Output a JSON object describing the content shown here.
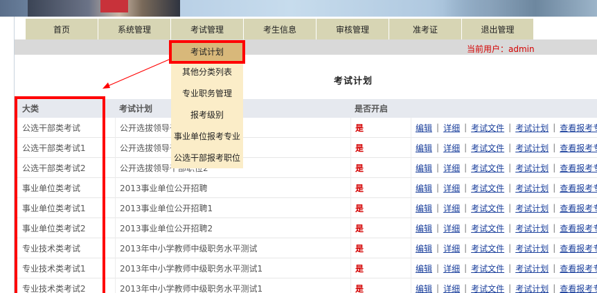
{
  "nav": {
    "items": [
      "首页",
      "系统管理",
      "考试管理",
      "考生信息",
      "审核管理",
      "准考证",
      "退出管理"
    ]
  },
  "status": {
    "current_user": "当前用户：admin"
  },
  "page": {
    "title": "考试计划"
  },
  "dropdown": {
    "items": [
      "考试计划",
      "其他分类列表",
      "专业职务管理",
      "报考级别",
      "事业单位报考专业",
      "公选干部报考职位"
    ]
  },
  "table": {
    "headers": [
      "大类",
      "考试计划",
      "是否开启",
      ""
    ],
    "actions": [
      "编辑",
      "详细",
      "考试文件",
      "考试计划",
      "查看报考专业"
    ],
    "rows": [
      {
        "category": "公选干部类考试",
        "plan": "公开选拔领导干部职位",
        "open": "是"
      },
      {
        "category": "公选干部类考试1",
        "plan": "公开选拔领导干部职位1",
        "open": "是"
      },
      {
        "category": "公选干部类考试2",
        "plan": "公开选拔领导干部职位2",
        "open": "是"
      },
      {
        "category": "事业单位类考试",
        "plan": "2013事业单位公开招聘",
        "open": "是"
      },
      {
        "category": "事业单位类考试1",
        "plan": "2013事业单位公开招聘1",
        "open": "是"
      },
      {
        "category": "事业单位类考试2",
        "plan": "2013事业单位公开招聘2",
        "open": "是"
      },
      {
        "category": "专业技术类考试",
        "plan": "2013年中小学教师中级职务水平测试",
        "open": "是"
      },
      {
        "category": "专业技术类考试1",
        "plan": "2013年中小学教师中级职务水平测试1",
        "open": "是"
      },
      {
        "category": "专业技术类考试2",
        "plan": "2013年中小学教师中级职务水平测试1",
        "open": "是"
      }
    ]
  },
  "colors": {
    "highlight": "#ff0000",
    "nav_bg": "#d7d5b4",
    "dropdown_bg": "#fbedc8",
    "link": "#1a3f9c"
  }
}
